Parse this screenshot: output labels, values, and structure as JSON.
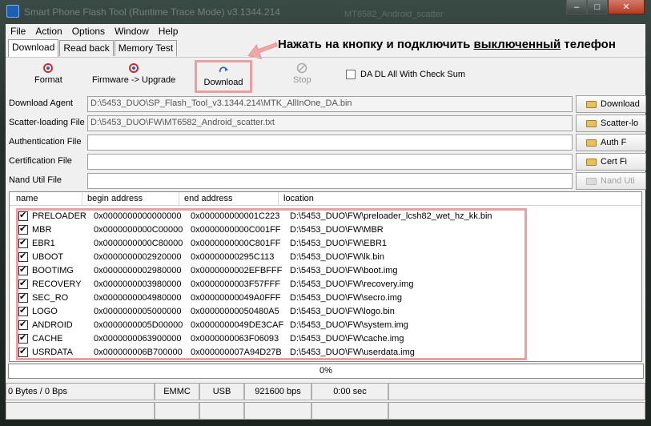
{
  "window": {
    "title": "Smart Phone Flash Tool (Runtime Trace Mode) v3.1344.214",
    "background_title": "MT6582_Android_scatter",
    "minimize": "–",
    "maximize": "□",
    "close": "✕"
  },
  "menu": [
    "File",
    "Action",
    "Options",
    "Window",
    "Help"
  ],
  "tabs": [
    "Download",
    "Read back",
    "Memory Test"
  ],
  "annotation": {
    "before": "Нажать на кнопку и подключить ",
    "underlined": "выключенный",
    "after": " телефон"
  },
  "toolbar": {
    "format": "Format",
    "firmware_upgrade": "Firmware -> Upgrade",
    "download": "Download",
    "stop": "Stop",
    "da_checksum": "DA DL All With Check Sum"
  },
  "files": [
    {
      "label": "Download Agent",
      "value": "D:\\5453_DUO\\SP_Flash_Tool_v3.1344.214\\MTK_AllInOne_DA.bin",
      "button": "Download",
      "gray": true
    },
    {
      "label": "Scatter-loading File",
      "value": "D:\\5453_DUO\\FW\\MT6582_Android_scatter.txt",
      "button": "Scatter-lo",
      "gray": true
    },
    {
      "label": "Authentication File",
      "value": "",
      "button": "Auth F",
      "gray": false
    },
    {
      "label": "Certification File",
      "value": "",
      "button": "Cert Fi",
      "gray": false
    },
    {
      "label": "Nand Util File",
      "value": "",
      "button": "Nand Uti",
      "gray": false
    }
  ],
  "list": {
    "headers": [
      "name",
      "begin address",
      "end address",
      "location"
    ],
    "rows": [
      {
        "name": "PRELOADER",
        "begin": "0x0000000000000000",
        "end": "0x000000000001C223",
        "location": "D:\\5453_DUO\\FW\\preloader_lcsh82_wet_hz_kk.bin"
      },
      {
        "name": "MBR",
        "begin": "0x0000000000C00000",
        "end": "0x0000000000C001FF",
        "location": "D:\\5453_DUO\\FW\\MBR"
      },
      {
        "name": "EBR1",
        "begin": "0x0000000000C80000",
        "end": "0x0000000000C801FF",
        "location": "D:\\5453_DUO\\FW\\EBR1"
      },
      {
        "name": "UBOOT",
        "begin": "0x0000000002920000",
        "end": "0x00000000295C113",
        "location": "D:\\5453_DUO\\FW\\lk.bin"
      },
      {
        "name": "BOOTIMG",
        "begin": "0x0000000002980000",
        "end": "0x0000000002EFBFFF",
        "location": "D:\\5453_DUO\\FW\\boot.img"
      },
      {
        "name": "RECOVERY",
        "begin": "0x0000000003980000",
        "end": "0x0000000003F57FFF",
        "location": "D:\\5453_DUO\\FW\\recovery.img"
      },
      {
        "name": "SEC_RO",
        "begin": "0x0000000004980000",
        "end": "0x00000000049A0FFF",
        "location": "D:\\5453_DUO\\FW\\secro.img"
      },
      {
        "name": "LOGO",
        "begin": "0x0000000005000000",
        "end": "0x00000000050480A5",
        "location": "D:\\5453_DUO\\FW\\logo.bin"
      },
      {
        "name": "ANDROID",
        "begin": "0x0000000005D00000",
        "end": "0x0000000049DE3CAF",
        "location": "D:\\5453_DUO\\FW\\system.img"
      },
      {
        "name": "CACHE",
        "begin": "0x0000000063900000",
        "end": "0x0000000063F06093",
        "location": "D:\\5453_DUO\\FW\\cache.img"
      },
      {
        "name": "USRDATA",
        "begin": "0x000000006B700000",
        "end": "0x000000007A94D27B",
        "location": "D:\\5453_DUO\\FW\\userdata.img"
      }
    ]
  },
  "progress": {
    "percent": 0,
    "label": "0%",
    "color": "#2f9e2f"
  },
  "status": {
    "transfer": "0 Bytes / 0 Bps",
    "storage": "EMMC",
    "port": "USB",
    "baud": "921600 bps",
    "time": "0:00 sec"
  },
  "colors": {
    "highlight": "#e8a0a0",
    "arrow": "#f0a0a0"
  }
}
